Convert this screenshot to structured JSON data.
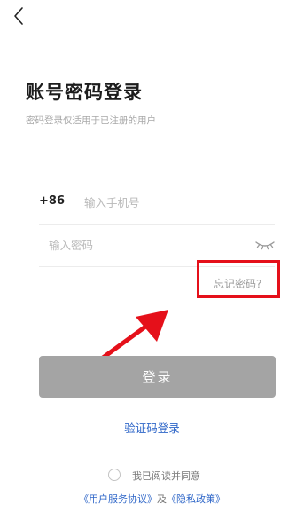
{
  "header": {
    "back_icon": "chevron-left-icon"
  },
  "page": {
    "title": "账号密码登录",
    "subtitle": "密码登录仅适用于已注册的用户"
  },
  "form": {
    "country_code": "+86",
    "phone_placeholder": "输入手机号",
    "phone_value": "",
    "password_placeholder": "输入密码",
    "password_value": "",
    "password_toggle_icon": "eye-closed-icon",
    "forgot_password": "忘记密码?",
    "login_button": "登录",
    "login_button_state": "disabled"
  },
  "alternate": {
    "sms_login": "验证码登录"
  },
  "agreement": {
    "checked": false,
    "text": "我已阅读并同意",
    "user_agreement": "《用户服务协议》",
    "and": "及",
    "privacy_policy": "《隐私政策》"
  },
  "annotation": {
    "highlight_color": "#e5101a",
    "arrow_icon": "arrow-up-right-icon"
  },
  "colors": {
    "link": "#2e66c8",
    "button_disabled": "#a4a4a4",
    "placeholder": "#b9b9b9"
  }
}
